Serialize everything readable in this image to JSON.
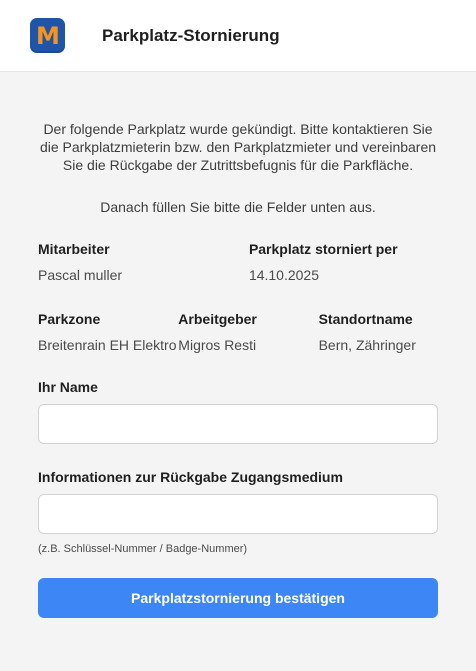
{
  "header": {
    "logo_letter": "M",
    "title": "Parkplatz-Stornierung"
  },
  "intro": {
    "text": "Der folgende Parkplatz wurde gekündigt. Bitte kontaktieren Sie die Parkplatzmieterin bzw. den Parkplatzmieter und vereinbaren Sie die Rückgabe der Zutrittsbefugnis für die Parkfläche.",
    "text2": "Danach füllen Sie bitte die Felder unten aus."
  },
  "details": {
    "mitarbeiter_label": "Mitarbeiter",
    "mitarbeiter_value": "Pascal muller",
    "storniert_label": "Parkplatz storniert per",
    "storniert_value": "14.10.2025",
    "parkzone_label": "Parkzone",
    "parkzone_value": "Breitenrain EH Elektro",
    "arbeitgeber_label": "Arbeitgeber",
    "arbeitgeber_value": "Migros Resti",
    "standort_label": "Standortname",
    "standort_value": "Bern, Zähringer"
  },
  "form": {
    "name_label": "Ihr Name",
    "name_value": "",
    "medium_label": "Informationen zur Rückgabe Zugangsmedium",
    "medium_value": "",
    "medium_hint": "(z.B. Schlüssel-Nummer / Badge-Nummer)",
    "submit_label": "Parkplatzstornierung bestätigen"
  },
  "colors": {
    "logo_bg": "#1f55a8",
    "logo_letter": "#f7941d",
    "primary_button": "#3d86f5",
    "page_bg": "#f4f4f4"
  }
}
